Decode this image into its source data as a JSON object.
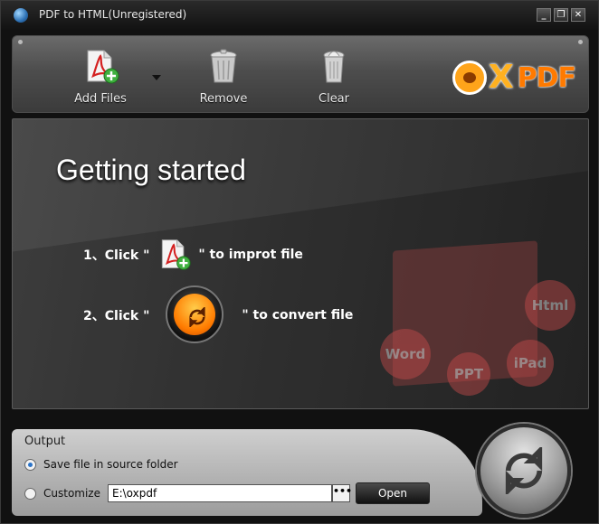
{
  "window": {
    "title": "PDF to HTML(Unregistered)",
    "controls": {
      "minimize": "_",
      "restore": "❐",
      "close": "✕"
    }
  },
  "toolbar": {
    "add_files_label": "Add Files",
    "remove_label": "Remove",
    "clear_label": "Clear",
    "brand_ox": "X",
    "brand_pdf": "PDF"
  },
  "main": {
    "heading": "Getting started",
    "step1_prefix": "1、Click \"",
    "step1_suffix": "\" to improt file",
    "step2_prefix": "2、Click \"",
    "step2_suffix": "\" to convert file",
    "watermark": {
      "html": "Html",
      "word": "Word",
      "ppt": "PPT",
      "ipad": "iPad"
    }
  },
  "output": {
    "title": "Output",
    "option_source": "Save file in source folder",
    "option_customize": "Customize",
    "path_value": "E:\\oxpdf",
    "browse_label": "•••",
    "open_label": "Open"
  },
  "colors": {
    "accent_orange": "#ff7a00",
    "brand_yellow": "#ffb120",
    "radio_checked": "#2a73c8"
  }
}
